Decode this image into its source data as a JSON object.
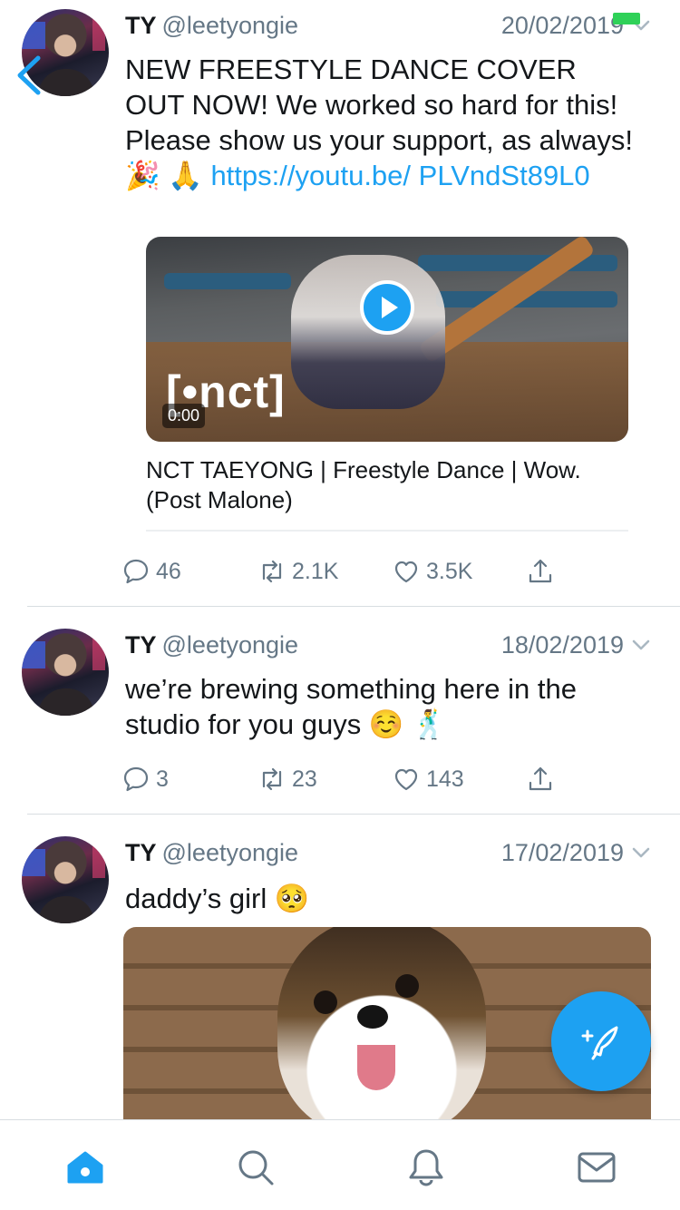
{
  "colors": {
    "accent": "#1da1f2",
    "text": "#14171a",
    "muted": "#657786",
    "divider": "#d8dde1"
  },
  "tweets": [
    {
      "name": "TY",
      "handle": "@leetyongie",
      "date": "20/02/2019",
      "text": "NEW FREESTYLE DANCE COVER OUT NOW! We worked so hard for this! Please show us your support, as always! 🎉 🙏 ",
      "link": "https://youtu.be/ PLVndSt89L0",
      "media": {
        "logo": "[•nct]",
        "duration": "0:00",
        "card_title": "NCT TAEYONG | Freestyle Dance | Wow. (Post Malone)"
      },
      "replies": "46",
      "retweets": "2.1K",
      "likes": "3.5K"
    },
    {
      "name": "TY",
      "handle": "@leetyongie",
      "date": "18/02/2019",
      "text": "we’re brewing something here in the studio for you guys ☺️ 🕺",
      "replies": "3",
      "retweets": "23",
      "likes": "143"
    },
    {
      "name": "TY",
      "handle": "@leetyongie",
      "date": "17/02/2019",
      "text": "daddy’s girl 🥺"
    }
  ],
  "icons": {
    "back": "chevron-left-icon",
    "reply": "reply-icon",
    "retweet": "retweet-icon",
    "like": "heart-icon",
    "share": "share-icon",
    "compose": "compose-tweet-icon",
    "tabs": [
      "home-icon",
      "search-icon",
      "notifications-icon",
      "messages-icon"
    ]
  }
}
